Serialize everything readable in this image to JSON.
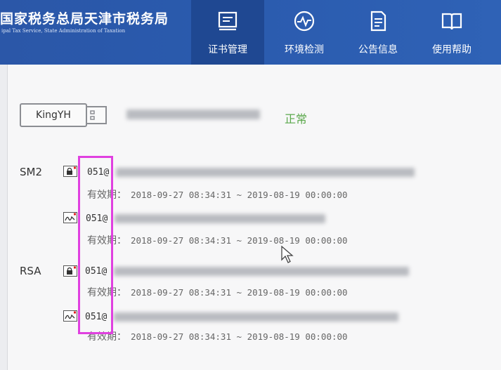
{
  "header": {
    "title": "国家税务总局天津市税务局",
    "subtitle": "ipal Tax Service, State Administration of Taxation"
  },
  "nav": [
    {
      "label": "证书管理",
      "icon": "certificate-icon",
      "active": true
    },
    {
      "label": "环境检测",
      "icon": "pulse-check-icon",
      "active": false
    },
    {
      "label": "公告信息",
      "icon": "document-icon",
      "active": false
    },
    {
      "label": "使用帮助",
      "icon": "book-icon",
      "active": false
    }
  ],
  "device": {
    "name": "KingYH",
    "icon": "usb-key-icon",
    "status": "正常",
    "status_color": "#5aa84b"
  },
  "groups": [
    {
      "algorithm": "SM2",
      "certs": [
        {
          "icon": "lock-cert-icon",
          "id_prefix": "051@",
          "validity_label": "有效期：",
          "validity_range": "2018-09-27 08:34:31 ~ 2019-08-19 00:00:00"
        },
        {
          "icon": "signature-cert-icon",
          "id_prefix": "051@",
          "validity_label": "有效期：",
          "validity_range": "2018-09-27 08:34:31 ~ 2019-08-19 00:00:00"
        }
      ]
    },
    {
      "algorithm": "RSA",
      "certs": [
        {
          "icon": "lock-cert-icon",
          "id_prefix": "051@",
          "validity_label": "有效期：",
          "validity_range": "2018-09-27 08:34:31 ~ 2019-08-19 00:00:00"
        },
        {
          "icon": "signature-cert-icon",
          "id_prefix": "051@",
          "validity_label": "有效期：",
          "validity_range": "2018-09-27 08:34:31 ~ 2019-08-19 00:00:00"
        }
      ]
    }
  ],
  "colors": {
    "header_bg": "#2a5aad",
    "nav_active_bg": "#1f4892",
    "highlight_border": "#e040e0"
  }
}
